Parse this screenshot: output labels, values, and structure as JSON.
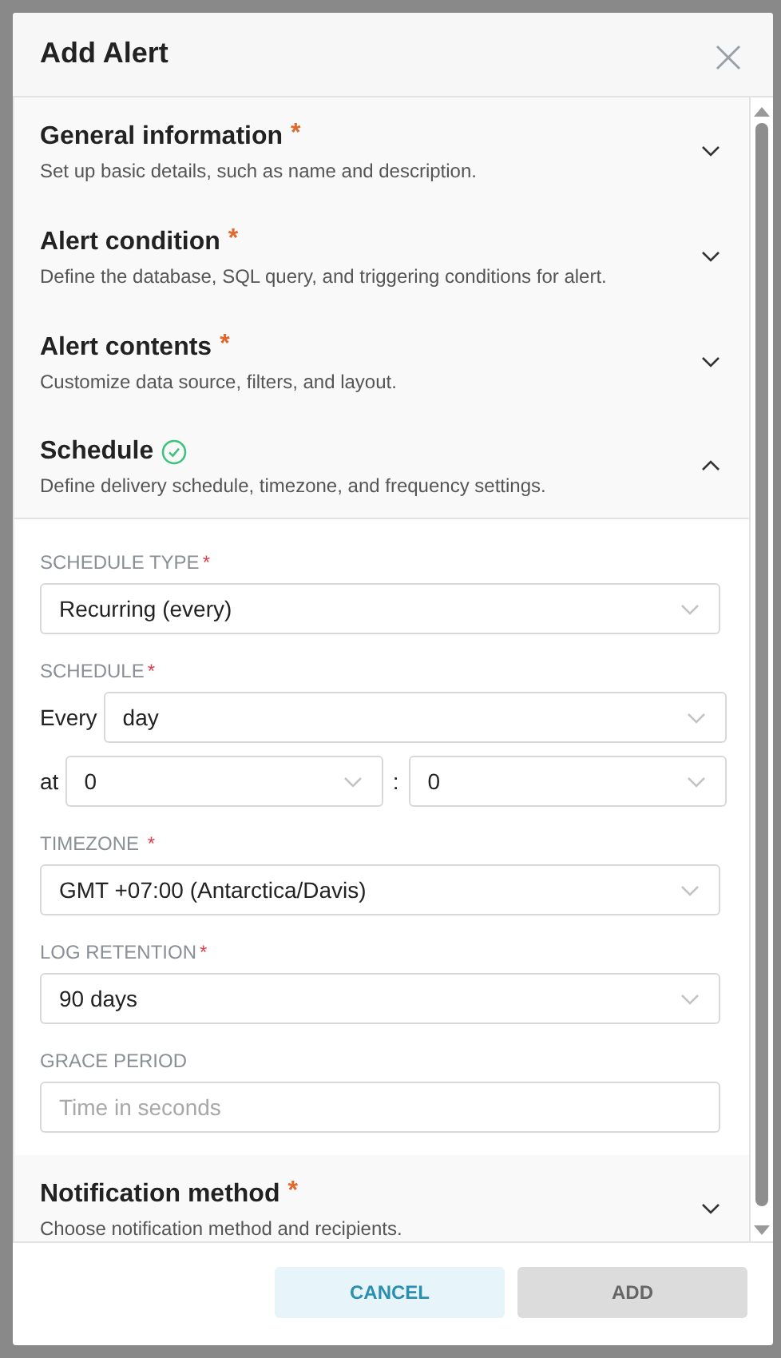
{
  "dialog": {
    "title": "Add Alert"
  },
  "sections": [
    {
      "title": "General information",
      "required_mark": "*",
      "complete": false,
      "description": "Set up basic details, such as name and description.",
      "expanded": false
    },
    {
      "title": "Alert condition",
      "required_mark": "*",
      "complete": false,
      "description": "Define the database, SQL query, and triggering conditions for alert.",
      "expanded": false
    },
    {
      "title": "Alert contents",
      "required_mark": "*",
      "complete": false,
      "description": "Customize data source, filters, and layout.",
      "expanded": false
    },
    {
      "title": "Schedule",
      "complete": true,
      "description": "Define delivery schedule, timezone, and frequency settings.",
      "expanded": true,
      "fields": [
        {
          "kind": "select",
          "label": "SCHEDULE TYPE",
          "required_mark": "*",
          "value": "Recurring (every)"
        },
        {
          "kind": "schedule",
          "label": "SCHEDULE",
          "required_mark": "*",
          "every_label": "Every",
          "every_value": "day",
          "at_label": "at",
          "hour": "0",
          "separator": ":",
          "minute": "0"
        },
        {
          "kind": "select",
          "label": "TIMEZONE ",
          "required_mark": "*",
          "value": "GMT +07:00 (Antarctica/Davis)"
        },
        {
          "kind": "select",
          "label": "LOG RETENTION",
          "required_mark": "*",
          "value": "90 days"
        },
        {
          "kind": "input",
          "label": "GRACE PERIOD",
          "placeholder": "Time in seconds"
        }
      ]
    },
    {
      "title": "Notification method",
      "required_mark": "*",
      "complete": false,
      "description": "Choose notification method and recipients.",
      "expanded": false
    }
  ],
  "buttons": [
    {
      "kind": "secondary",
      "label": "CANCEL",
      "disabled": false
    },
    {
      "kind": "primary",
      "label": "ADD",
      "disabled": true
    }
  ]
}
